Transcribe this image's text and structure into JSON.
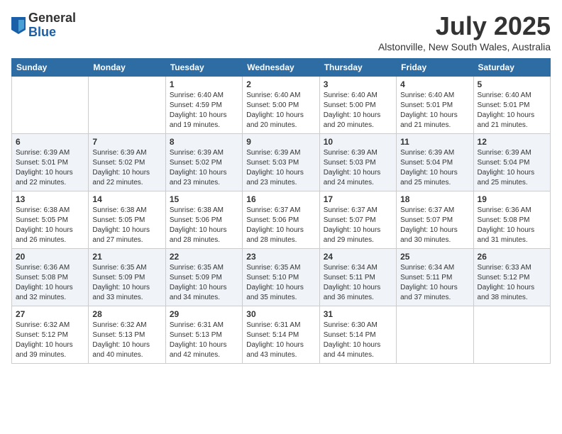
{
  "header": {
    "logo_general": "General",
    "logo_blue": "Blue",
    "month_title": "July 2025",
    "location": "Alstonville, New South Wales, Australia"
  },
  "calendar": {
    "days_of_week": [
      "Sunday",
      "Monday",
      "Tuesday",
      "Wednesday",
      "Thursday",
      "Friday",
      "Saturday"
    ],
    "weeks": [
      [
        {
          "day": "",
          "info": ""
        },
        {
          "day": "",
          "info": ""
        },
        {
          "day": "1",
          "info": "Sunrise: 6:40 AM\nSunset: 4:59 PM\nDaylight: 10 hours and 19 minutes."
        },
        {
          "day": "2",
          "info": "Sunrise: 6:40 AM\nSunset: 5:00 PM\nDaylight: 10 hours and 20 minutes."
        },
        {
          "day": "3",
          "info": "Sunrise: 6:40 AM\nSunset: 5:00 PM\nDaylight: 10 hours and 20 minutes."
        },
        {
          "day": "4",
          "info": "Sunrise: 6:40 AM\nSunset: 5:01 PM\nDaylight: 10 hours and 21 minutes."
        },
        {
          "day": "5",
          "info": "Sunrise: 6:40 AM\nSunset: 5:01 PM\nDaylight: 10 hours and 21 minutes."
        }
      ],
      [
        {
          "day": "6",
          "info": "Sunrise: 6:39 AM\nSunset: 5:01 PM\nDaylight: 10 hours and 22 minutes."
        },
        {
          "day": "7",
          "info": "Sunrise: 6:39 AM\nSunset: 5:02 PM\nDaylight: 10 hours and 22 minutes."
        },
        {
          "day": "8",
          "info": "Sunrise: 6:39 AM\nSunset: 5:02 PM\nDaylight: 10 hours and 23 minutes."
        },
        {
          "day": "9",
          "info": "Sunrise: 6:39 AM\nSunset: 5:03 PM\nDaylight: 10 hours and 23 minutes."
        },
        {
          "day": "10",
          "info": "Sunrise: 6:39 AM\nSunset: 5:03 PM\nDaylight: 10 hours and 24 minutes."
        },
        {
          "day": "11",
          "info": "Sunrise: 6:39 AM\nSunset: 5:04 PM\nDaylight: 10 hours and 25 minutes."
        },
        {
          "day": "12",
          "info": "Sunrise: 6:39 AM\nSunset: 5:04 PM\nDaylight: 10 hours and 25 minutes."
        }
      ],
      [
        {
          "day": "13",
          "info": "Sunrise: 6:38 AM\nSunset: 5:05 PM\nDaylight: 10 hours and 26 minutes."
        },
        {
          "day": "14",
          "info": "Sunrise: 6:38 AM\nSunset: 5:05 PM\nDaylight: 10 hours and 27 minutes."
        },
        {
          "day": "15",
          "info": "Sunrise: 6:38 AM\nSunset: 5:06 PM\nDaylight: 10 hours and 28 minutes."
        },
        {
          "day": "16",
          "info": "Sunrise: 6:37 AM\nSunset: 5:06 PM\nDaylight: 10 hours and 28 minutes."
        },
        {
          "day": "17",
          "info": "Sunrise: 6:37 AM\nSunset: 5:07 PM\nDaylight: 10 hours and 29 minutes."
        },
        {
          "day": "18",
          "info": "Sunrise: 6:37 AM\nSunset: 5:07 PM\nDaylight: 10 hours and 30 minutes."
        },
        {
          "day": "19",
          "info": "Sunrise: 6:36 AM\nSunset: 5:08 PM\nDaylight: 10 hours and 31 minutes."
        }
      ],
      [
        {
          "day": "20",
          "info": "Sunrise: 6:36 AM\nSunset: 5:08 PM\nDaylight: 10 hours and 32 minutes."
        },
        {
          "day": "21",
          "info": "Sunrise: 6:35 AM\nSunset: 5:09 PM\nDaylight: 10 hours and 33 minutes."
        },
        {
          "day": "22",
          "info": "Sunrise: 6:35 AM\nSunset: 5:09 PM\nDaylight: 10 hours and 34 minutes."
        },
        {
          "day": "23",
          "info": "Sunrise: 6:35 AM\nSunset: 5:10 PM\nDaylight: 10 hours and 35 minutes."
        },
        {
          "day": "24",
          "info": "Sunrise: 6:34 AM\nSunset: 5:11 PM\nDaylight: 10 hours and 36 minutes."
        },
        {
          "day": "25",
          "info": "Sunrise: 6:34 AM\nSunset: 5:11 PM\nDaylight: 10 hours and 37 minutes."
        },
        {
          "day": "26",
          "info": "Sunrise: 6:33 AM\nSunset: 5:12 PM\nDaylight: 10 hours and 38 minutes."
        }
      ],
      [
        {
          "day": "27",
          "info": "Sunrise: 6:32 AM\nSunset: 5:12 PM\nDaylight: 10 hours and 39 minutes."
        },
        {
          "day": "28",
          "info": "Sunrise: 6:32 AM\nSunset: 5:13 PM\nDaylight: 10 hours and 40 minutes."
        },
        {
          "day": "29",
          "info": "Sunrise: 6:31 AM\nSunset: 5:13 PM\nDaylight: 10 hours and 42 minutes."
        },
        {
          "day": "30",
          "info": "Sunrise: 6:31 AM\nSunset: 5:14 PM\nDaylight: 10 hours and 43 minutes."
        },
        {
          "day": "31",
          "info": "Sunrise: 6:30 AM\nSunset: 5:14 PM\nDaylight: 10 hours and 44 minutes."
        },
        {
          "day": "",
          "info": ""
        },
        {
          "day": "",
          "info": ""
        }
      ]
    ]
  }
}
